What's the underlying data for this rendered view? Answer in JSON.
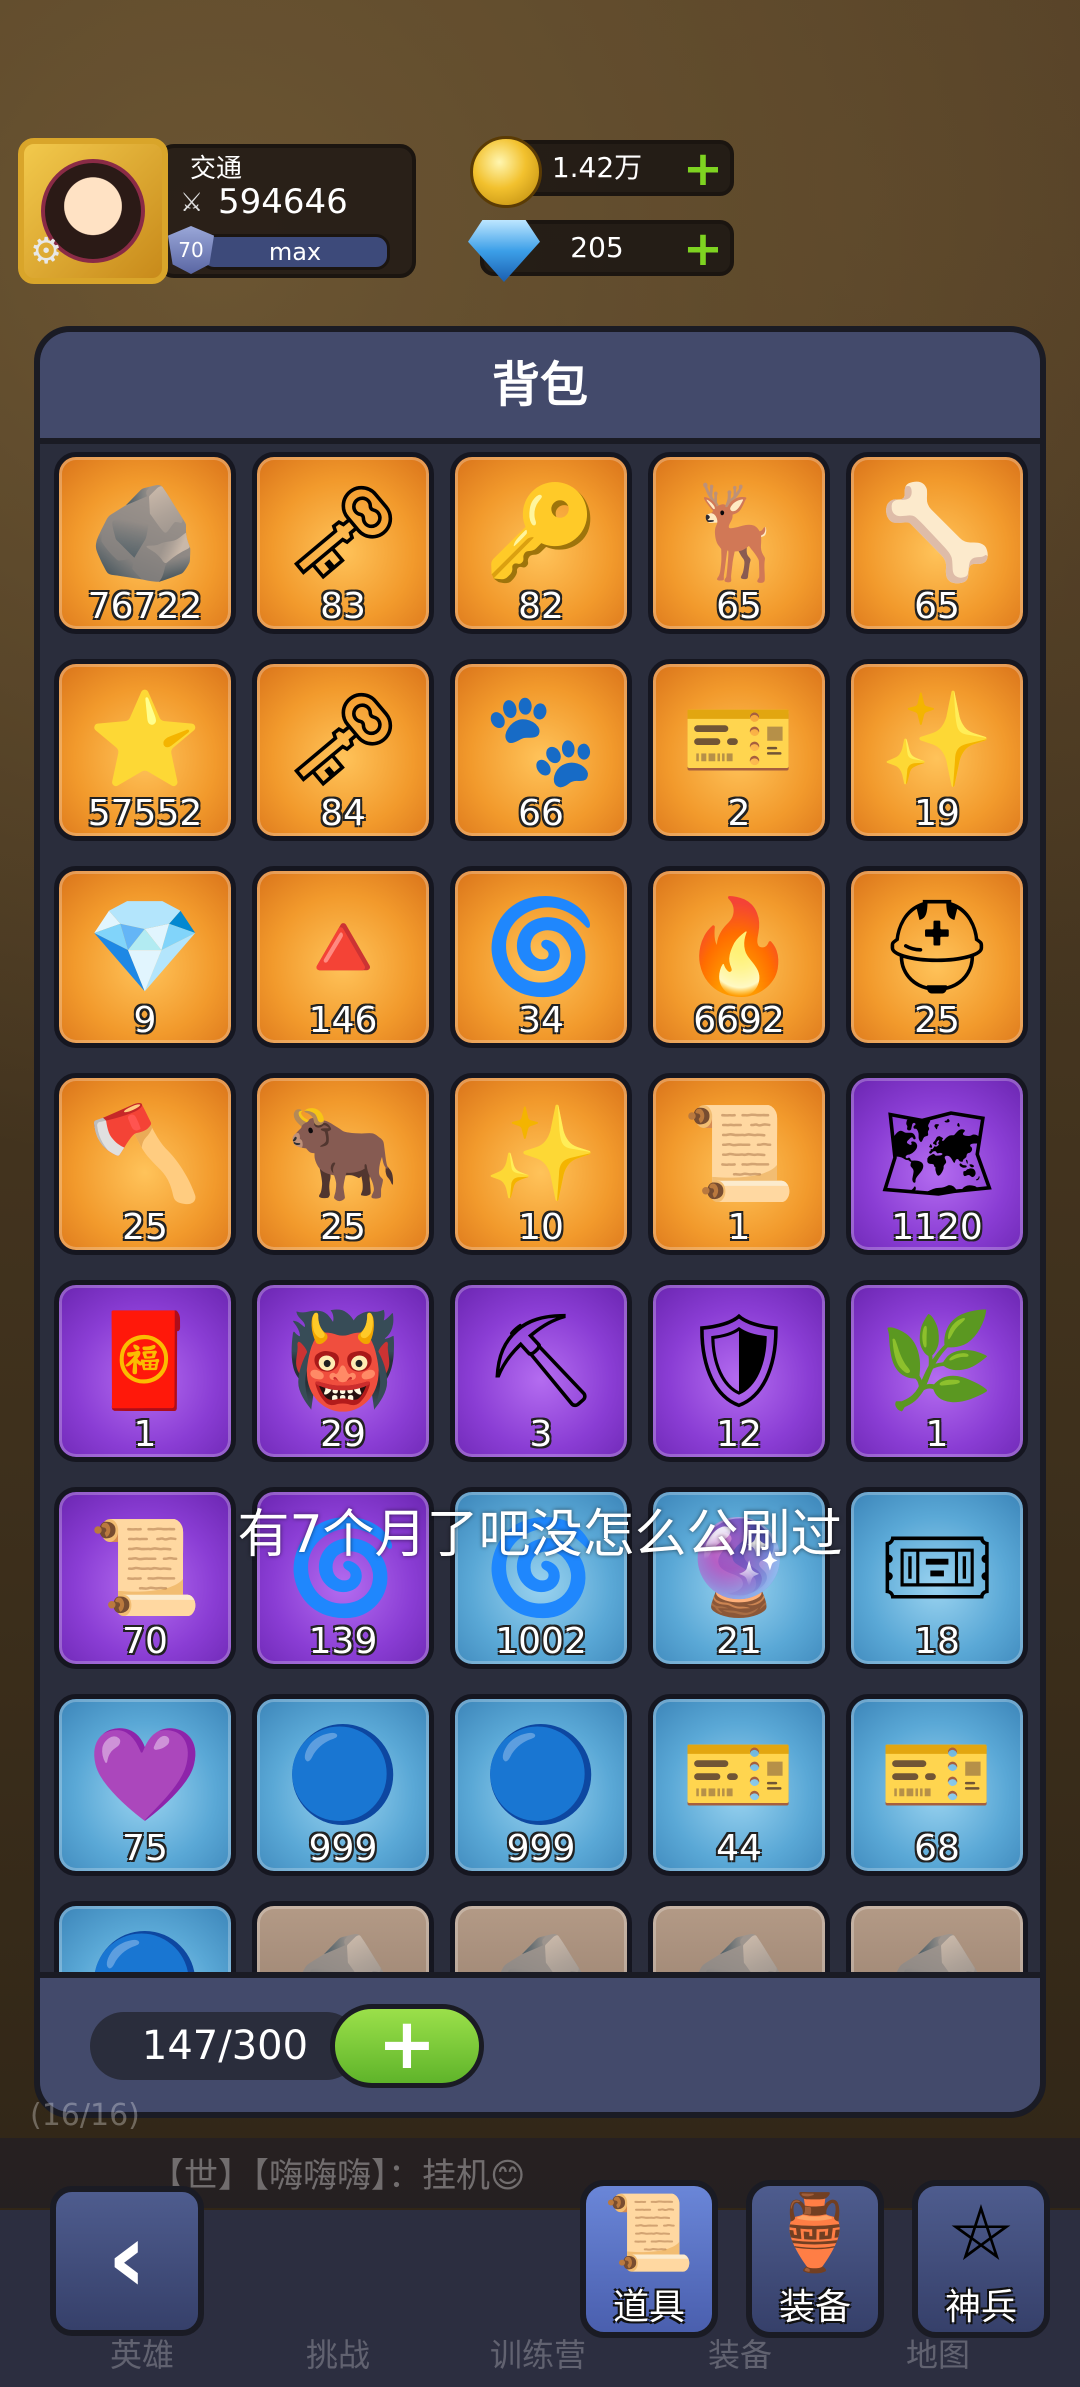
{
  "player": {
    "name": "交通",
    "power": "594646",
    "level": "70",
    "level_status": "max"
  },
  "currency": {
    "gold": "1.42万",
    "gems": "205"
  },
  "backpack": {
    "title": "背包",
    "capacity": "147/300",
    "overlay_text": "有7个月了吧没怎么公刷过"
  },
  "items": [
    {
      "icon": "blue-rune-stone-icon",
      "glyph": "🪨",
      "count": "76722",
      "rarity": "orange"
    },
    {
      "icon": "silver-key-icon",
      "glyph": "🗝",
      "count": "83",
      "rarity": "orange"
    },
    {
      "icon": "gold-key-icon",
      "glyph": "🔑",
      "count": "82",
      "rarity": "orange"
    },
    {
      "icon": "antler-icon",
      "glyph": "🦌",
      "count": "65",
      "rarity": "orange"
    },
    {
      "icon": "red-horn-icon",
      "glyph": "🦴",
      "count": "65",
      "rarity": "orange"
    },
    {
      "icon": "star-stone-icon",
      "glyph": "⭐",
      "count": "57552",
      "rarity": "orange"
    },
    {
      "icon": "bronze-key-icon",
      "glyph": "🗝",
      "count": "84",
      "rarity": "orange"
    },
    {
      "icon": "bear-paw-icon",
      "glyph": "🐾",
      "count": "66",
      "rarity": "orange"
    },
    {
      "icon": "gold-ticket-icon",
      "glyph": "🎫",
      "count": "2",
      "rarity": "orange"
    },
    {
      "icon": "purple-dust-icon",
      "glyph": "✨",
      "count": "19",
      "rarity": "orange"
    },
    {
      "icon": "blue-crystal-pile-icon",
      "glyph": "💎",
      "count": "9",
      "rarity": "orange"
    },
    {
      "icon": "red-crystal-icon",
      "glyph": "🔺",
      "count": "146",
      "rarity": "orange"
    },
    {
      "icon": "purple-swirl-stone-icon",
      "glyph": "🌀",
      "count": "34",
      "rarity": "orange"
    },
    {
      "icon": "fire-rune-stone-icon",
      "glyph": "🔥",
      "count": "6692",
      "rarity": "orange"
    },
    {
      "icon": "horned-helmet-icon",
      "glyph": "⛑",
      "count": "25",
      "rarity": "orange"
    },
    {
      "icon": "axe-icon",
      "glyph": "🪓",
      "count": "25",
      "rarity": "orange"
    },
    {
      "icon": "horned-cap-icon",
      "glyph": "🐂",
      "count": "25",
      "rarity": "orange"
    },
    {
      "icon": "gold-dust-icon",
      "glyph": "✨",
      "count": "10",
      "rarity": "orange"
    },
    {
      "icon": "gold-scroll-icon",
      "glyph": "📜",
      "count": "1",
      "rarity": "orange"
    },
    {
      "icon": "treasure-map-icon",
      "glyph": "🗺",
      "count": "1120",
      "rarity": "purple"
    },
    {
      "icon": "fortune-lantern-icon",
      "glyph": "🧧",
      "count": "1",
      "rarity": "purple"
    },
    {
      "icon": "tiki-mask-icon",
      "glyph": "👹",
      "count": "29",
      "rarity": "purple"
    },
    {
      "icon": "shovel-icon",
      "glyph": "⛏",
      "count": "3",
      "rarity": "purple"
    },
    {
      "icon": "shield-coin-icon",
      "glyph": "🛡",
      "count": "12",
      "rarity": "purple"
    },
    {
      "icon": "herb-leaf-icon",
      "glyph": "🌿",
      "count": "1",
      "rarity": "purple"
    },
    {
      "icon": "ribbon-scroll-icon",
      "glyph": "📜",
      "count": "70",
      "rarity": "purple"
    },
    {
      "icon": "gold-swirl-stone-icon",
      "glyph": "🌀",
      "count": "139",
      "rarity": "purple"
    },
    {
      "icon": "blue-swirl-stone-icon",
      "glyph": "🌀",
      "count": "1002",
      "rarity": "blue"
    },
    {
      "icon": "pink-crystal-icon",
      "glyph": "🔮",
      "count": "21",
      "rarity": "blue"
    },
    {
      "icon": "brown-ticket-icon",
      "glyph": "🎟",
      "count": "18",
      "rarity": "blue"
    },
    {
      "icon": "purple-gem-icon",
      "glyph": "💜",
      "count": "75",
      "rarity": "blue"
    },
    {
      "icon": "blue-orb-icon",
      "glyph": "🔵",
      "count": "999",
      "rarity": "blue"
    },
    {
      "icon": "blue-orb-icon",
      "glyph": "🔵",
      "count": "999",
      "rarity": "blue"
    },
    {
      "icon": "red-gold-ticket-icon",
      "glyph": "🎫",
      "count": "44",
      "rarity": "blue"
    },
    {
      "icon": "blue-ticket-icon",
      "glyph": "🎫",
      "count": "68",
      "rarity": "blue"
    },
    {
      "icon": "blue-orb-icon",
      "glyph": "🔵",
      "count": "",
      "rarity": "blue"
    },
    {
      "icon": "stone-shard-icon",
      "glyph": "🪨",
      "count": "",
      "rarity": "brown"
    },
    {
      "icon": "stone-shard-icon",
      "glyph": "🪨",
      "count": "",
      "rarity": "brown"
    },
    {
      "icon": "stone-shard-icon",
      "glyph": "🪨",
      "count": "",
      "rarity": "brown"
    },
    {
      "icon": "stone-shard-icon",
      "glyph": "🪨",
      "count": "",
      "rarity": "brown"
    }
  ],
  "background": {
    "page_count": "(16/16)",
    "chat": "【世】【嗨嗨嗨】：挂机😊",
    "nav_hidden": [
      "英雄",
      "挑战",
      "训练营",
      "装备",
      "地图"
    ]
  },
  "tabs": [
    {
      "name": "tab-items",
      "label": "道具",
      "glyph": "📜",
      "active": true
    },
    {
      "name": "tab-equipment",
      "label": "装备",
      "glyph": "🏺",
      "active": false
    },
    {
      "name": "tab-divine-weapons",
      "label": "神兵",
      "glyph": "⛤",
      "active": false
    }
  ],
  "colors": {
    "panel": "#2a2d3c",
    "panel_header": "#434a6b",
    "orange_rarity": "#f29a2c",
    "purple_rarity": "#8a3dd4",
    "blue_rarity": "#5aa8d6",
    "plus_green": "#7ed321"
  }
}
